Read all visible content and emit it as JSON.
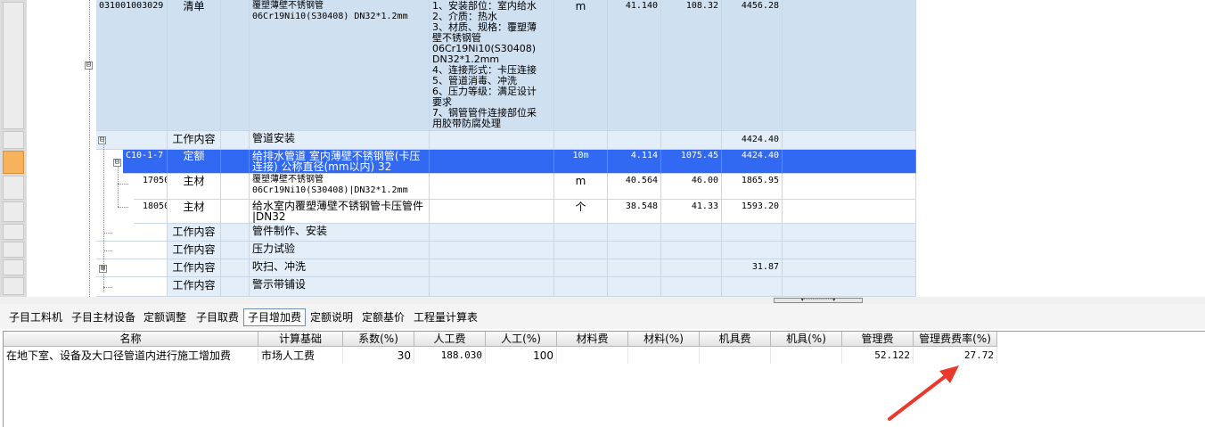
{
  "upper_grid": {
    "rows": [
      {
        "code": "031001003029",
        "category": "清单",
        "name": "覆塑薄壁不锈钢管\n06Cr19Ni10(S30408) DN32*1.2mm",
        "features": "1、安装部位：室内给水\n2、介质：热水\n3、材质、规格：覆塑薄\n壁不锈钢管\n06Cr19Ni10(S30408)\nDN32*1.2mm\n4、连接形式：卡压连接\n5、管道消毒、冲洗\n6、压力等级：满足设计\n要求\n7、钢管管件连接部位采\n用胶带防腐处理",
        "unit": "m",
        "qty": "41.140",
        "price": "108.32",
        "total": "4456.28",
        "expander": "⊟"
      },
      {
        "code": "",
        "category": "工作内容",
        "name": "管道安装",
        "features": "",
        "unit": "",
        "qty": "",
        "price": "",
        "total": "4424.40",
        "expander": "⊟"
      },
      {
        "code": "C10-1-7",
        "category": "定额",
        "name": "给排水管道 室内薄壁不锈钢管(卡压\n连接) 公称直径(mm以内) 32",
        "features": "",
        "unit": "10m",
        "qty": "4.114",
        "price": "1075.45",
        "total": "4424.40",
        "expander": "⊟"
      },
      {
        "code": "17050",
        "category": "主材",
        "name": "覆塑薄壁不锈钢管\n06Cr19Ni10(S30408)|DN32*1.2mm",
        "features": "",
        "unit": "m",
        "qty": "40.564",
        "price": "46.00",
        "total": "1865.95"
      },
      {
        "code": "18050",
        "category": "主材",
        "name": "给水室内覆塑薄壁不锈钢管卡压管件\n|DN32",
        "features": "",
        "unit": "个",
        "qty": "38.548",
        "price": "41.33",
        "total": "1593.20"
      },
      {
        "code": "",
        "category": "工作内容",
        "name": "管件制作、安装",
        "features": "",
        "unit": "",
        "qty": "",
        "price": "",
        "total": ""
      },
      {
        "code": "",
        "category": "工作内容",
        "name": "压力试验",
        "features": "",
        "unit": "",
        "qty": "",
        "price": "",
        "total": ""
      },
      {
        "code": "",
        "category": "工作内容",
        "name": "吹扫、冲洗",
        "features": "",
        "unit": "",
        "qty": "",
        "price": "",
        "total": "31.87",
        "expander": "⊞"
      },
      {
        "code": "",
        "category": "工作内容",
        "name": "警示带铺设",
        "features": "",
        "unit": "",
        "qty": "",
        "price": "",
        "total": ""
      }
    ]
  },
  "splitter_grip": "▾·················▾",
  "tabs": [
    {
      "label": "子目工料机"
    },
    {
      "label": "子目主材设备"
    },
    {
      "label": "定额调整"
    },
    {
      "label": "子目取费"
    },
    {
      "label": "子目增加费",
      "active": true
    },
    {
      "label": "定额说明"
    },
    {
      "label": "定额基价"
    },
    {
      "label": "工程量计算表"
    }
  ],
  "lower_grid": {
    "headers": [
      "名称",
      "计算基础",
      "系数(%)",
      "人工费",
      "人工(%)",
      "材料费",
      "材料(%)",
      "机具费",
      "机具(%)",
      "管理费",
      "管理费费率(%)"
    ],
    "rows": [
      [
        "在地下室、设备及大口径管道内进行施工增加费",
        "市场人工费",
        "30",
        "188.030",
        "100",
        "",
        "",
        "",
        "",
        "52.122",
        "27.72"
      ]
    ]
  },
  "colors": {
    "selected_row": "#3169f2",
    "clause_row": "#cfe0f1",
    "work_row": "#e4eef8",
    "annotation_arrow": "#e8392a"
  }
}
